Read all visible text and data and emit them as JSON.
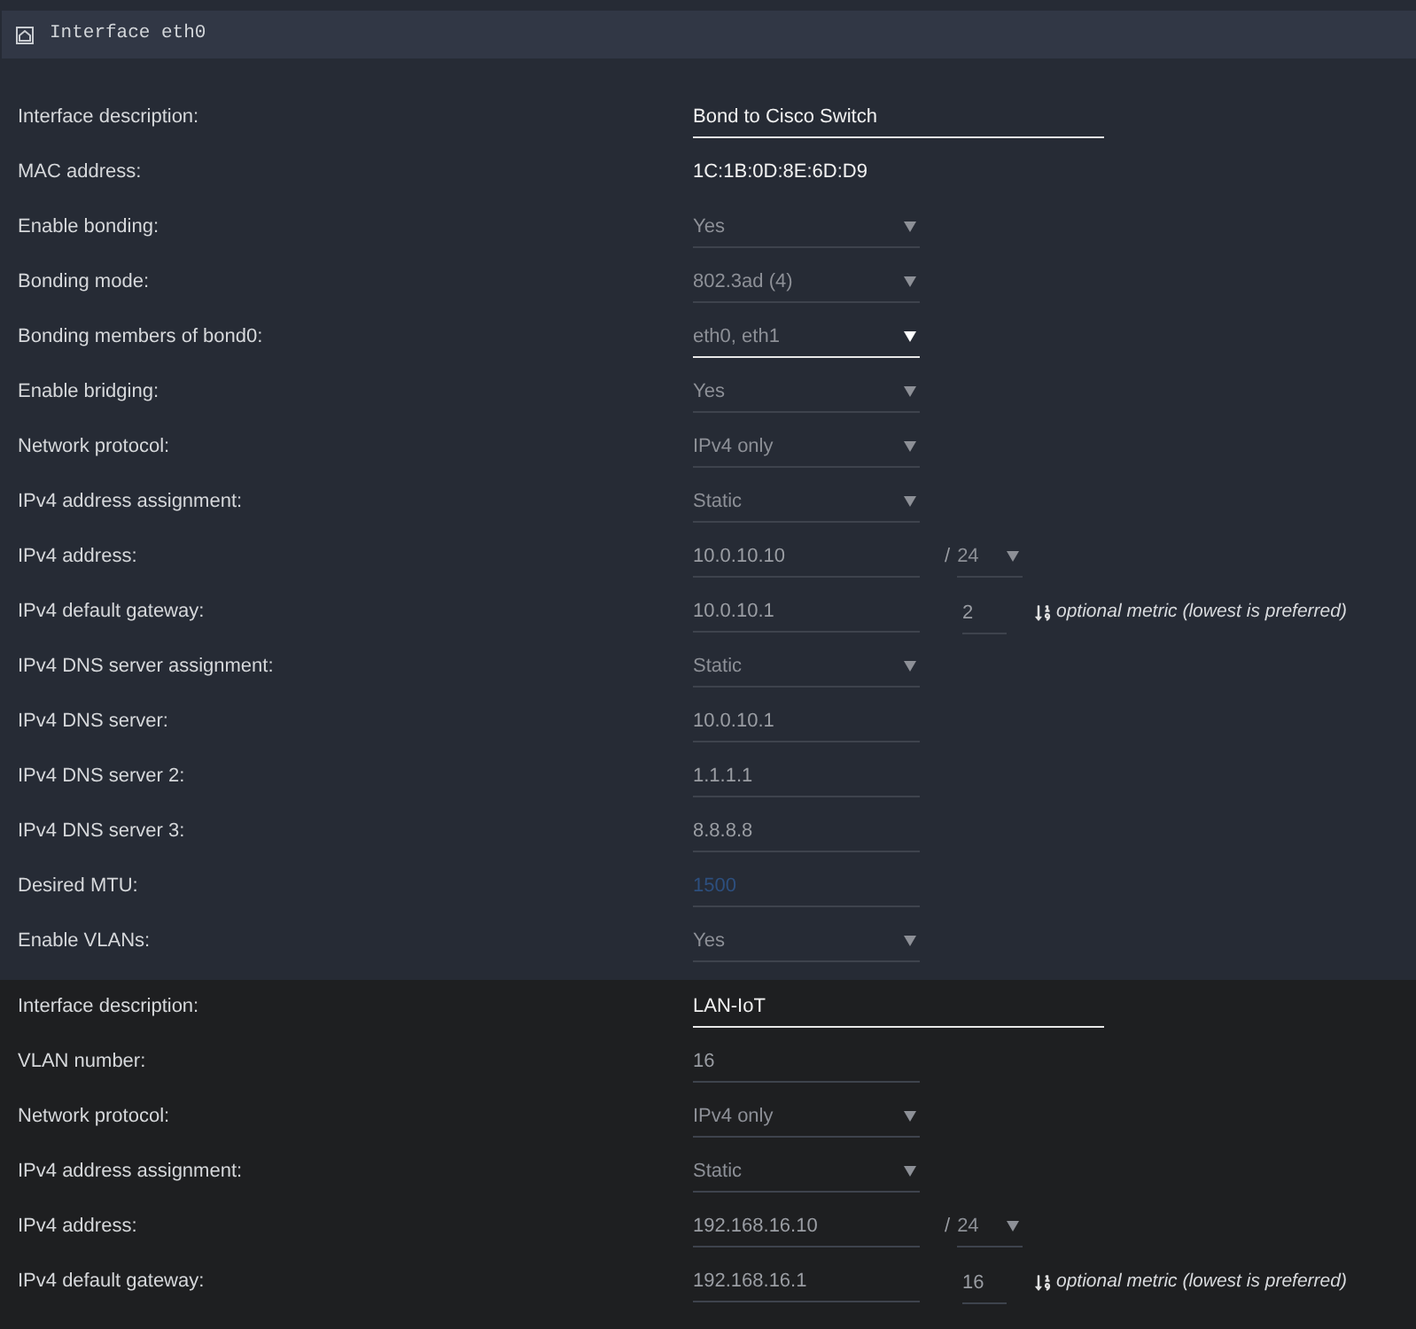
{
  "header": {
    "title": "Interface eth0"
  },
  "sections": [
    {
      "kind": "interface",
      "rows": [
        {
          "label": "Interface description:",
          "kind": "text",
          "value": "Bond to Cisco Switch"
        },
        {
          "label": "MAC address:",
          "kind": "static",
          "value": "1C:1B:0D:8E:6D:D9"
        },
        {
          "label": "Enable bonding:",
          "kind": "select",
          "value": "Yes",
          "highlighted": false
        },
        {
          "label": "Bonding mode:",
          "kind": "select",
          "value": "802.3ad (4)",
          "highlighted": false
        },
        {
          "label": "Bonding members of bond0:",
          "kind": "select",
          "value": "eth0, eth1",
          "highlighted": true
        },
        {
          "label": "Enable bridging:",
          "kind": "select",
          "value": "Yes",
          "highlighted": false
        },
        {
          "label": "Network protocol:",
          "kind": "select",
          "value": "IPv4 only",
          "highlighted": false
        },
        {
          "label": "IPv4 address assignment:",
          "kind": "select",
          "value": "Static",
          "highlighted": false
        },
        {
          "label": "IPv4 address:",
          "kind": "address",
          "value": "10.0.10.10",
          "separator": "/",
          "prefix": "24"
        },
        {
          "label": "IPv4 default gateway:",
          "kind": "gateway",
          "value": "10.0.10.1",
          "metric": "2",
          "hint": "optional metric (lowest is preferred)"
        },
        {
          "label": "IPv4 DNS server assignment:",
          "kind": "select",
          "value": "Static",
          "highlighted": false
        },
        {
          "label": "IPv4 DNS server:",
          "kind": "input",
          "value": "10.0.10.1"
        },
        {
          "label": "IPv4 DNS server 2:",
          "kind": "input",
          "value": "1.1.1.1"
        },
        {
          "label": "IPv4 DNS server 3:",
          "kind": "input",
          "value": "8.8.8.8"
        },
        {
          "label": "Desired MTU:",
          "kind": "input",
          "placeholder": "1500"
        },
        {
          "label": "Enable VLANs:",
          "kind": "select",
          "value": "Yes",
          "highlighted": false
        }
      ]
    },
    {
      "kind": "vlan",
      "rows": [
        {
          "label": "Interface description:",
          "kind": "text",
          "value": "LAN-IoT"
        },
        {
          "label": "VLAN number:",
          "kind": "input",
          "value": "16"
        },
        {
          "label": "Network protocol:",
          "kind": "select",
          "value": "IPv4 only",
          "highlighted": false
        },
        {
          "label": "IPv4 address assignment:",
          "kind": "select",
          "value": "Static",
          "highlighted": false
        },
        {
          "label": "IPv4 address:",
          "kind": "address",
          "value": "192.168.16.10",
          "separator": "/",
          "prefix": "24"
        },
        {
          "label": "IPv4 default gateway:",
          "kind": "gateway",
          "value": "192.168.16.1",
          "metric": "16",
          "hint": "optional metric (lowest is preferred)"
        }
      ]
    }
  ]
}
